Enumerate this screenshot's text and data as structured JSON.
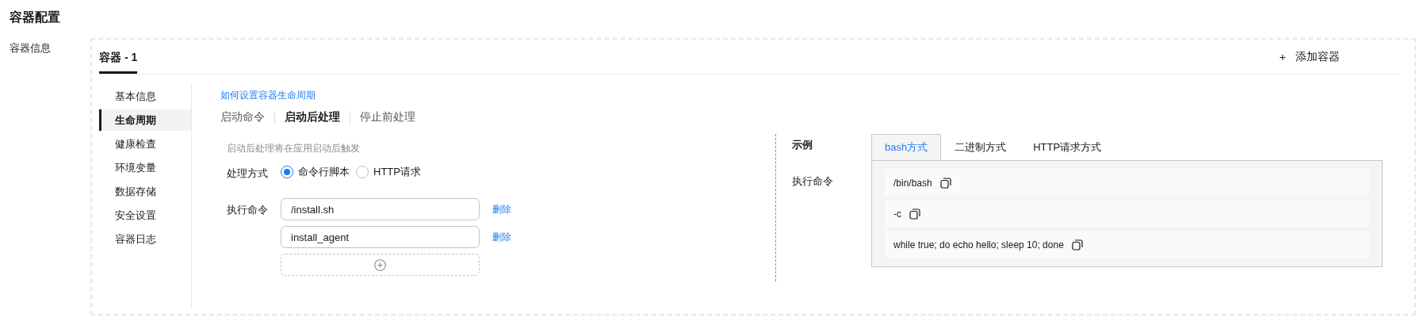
{
  "page_title": "容器配置",
  "section_label": "容器信息",
  "container_tabs": [
    {
      "label": "容器 - 1",
      "selected": true
    }
  ],
  "add_container": {
    "icon": "+",
    "label": "添加容器"
  },
  "side_menu": [
    {
      "label": "基本信息",
      "selected": false
    },
    {
      "label": "生命周期",
      "selected": true
    },
    {
      "label": "健康检查",
      "selected": false
    },
    {
      "label": "环境变量",
      "selected": false
    },
    {
      "label": "数据存储",
      "selected": false
    },
    {
      "label": "安全设置",
      "selected": false
    },
    {
      "label": "容器日志",
      "selected": false
    }
  ],
  "help_link": "如何设置容器生命周期",
  "lifecycle_tabs": [
    {
      "label": "启动命令",
      "selected": false
    },
    {
      "label": "启动后处理",
      "selected": true
    },
    {
      "label": "停止前处理",
      "selected": false
    }
  ],
  "form": {
    "hint": "启动后处理将在应用启动后触发",
    "method_label": "处理方式",
    "methods": [
      {
        "label": "命令行脚本",
        "selected": true
      },
      {
        "label": "HTTP请求",
        "selected": false
      }
    ],
    "command_label": "执行命令",
    "commands": [
      {
        "value": "/install.sh",
        "action": "删除"
      },
      {
        "value": "install_agent",
        "action": "删除"
      }
    ]
  },
  "example": {
    "title": "示例",
    "command_label": "执行命令",
    "tabs": [
      {
        "label": "bash方式",
        "selected": true
      },
      {
        "label": "二进制方式",
        "selected": false
      },
      {
        "label": "HTTP请求方式",
        "selected": false
      }
    ],
    "lines": [
      "/bin/bash",
      "-c",
      "while true; do echo hello; sleep 10; done"
    ]
  }
}
